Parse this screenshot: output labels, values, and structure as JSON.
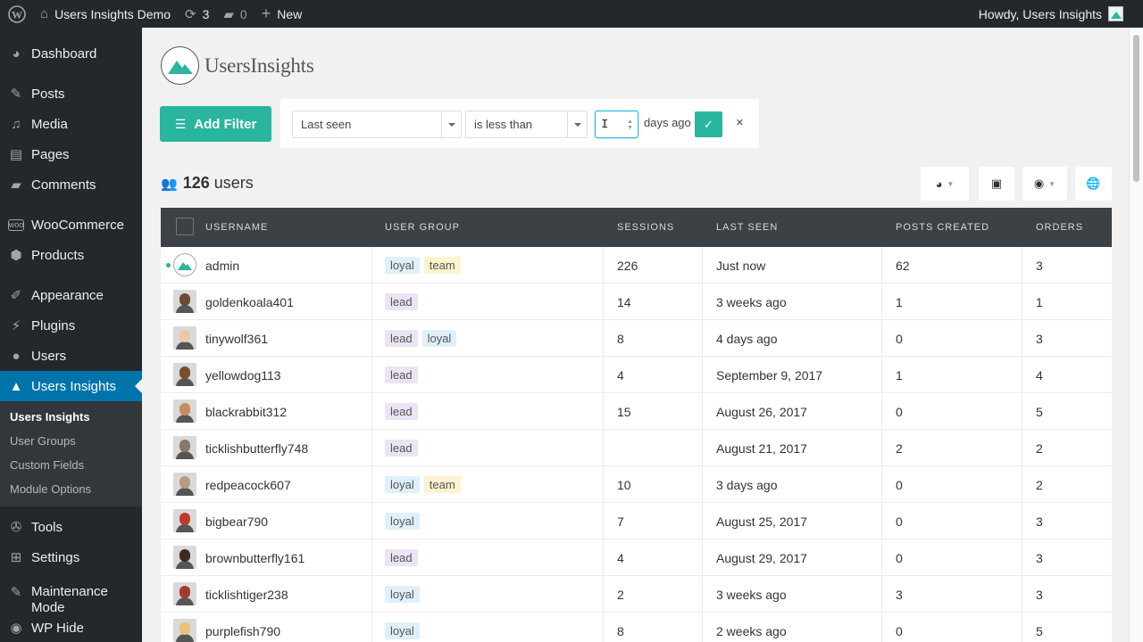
{
  "adminbar": {
    "site_name": "Users Insights Demo",
    "updates_count": "3",
    "comments_count": "0",
    "new_label": "New",
    "howdy": "Howdy, Users Insights"
  },
  "sidebar": {
    "items": [
      {
        "label": "Dashboard",
        "icon": "dashboard-icon"
      },
      {
        "label": "Posts",
        "icon": "pin-icon"
      },
      {
        "label": "Media",
        "icon": "media-icon"
      },
      {
        "label": "Pages",
        "icon": "pages-icon"
      },
      {
        "label": "Comments",
        "icon": "comments-icon"
      },
      {
        "label": "WooCommerce",
        "icon": "woo-icon"
      },
      {
        "label": "Products",
        "icon": "products-icon"
      },
      {
        "label": "Appearance",
        "icon": "brush-icon"
      },
      {
        "label": "Plugins",
        "icon": "plugin-icon"
      },
      {
        "label": "Users",
        "icon": "user-icon"
      },
      {
        "label": "Users Insights",
        "icon": "mountain-icon"
      }
    ],
    "submenu": [
      "Users Insights",
      "User Groups",
      "Custom Fields",
      "Module Options"
    ],
    "bottom_items": [
      {
        "label": "Tools",
        "icon": "wrench-icon"
      },
      {
        "label": "Settings",
        "icon": "settings-icon"
      },
      {
        "label": "Maintenance\nMode",
        "icon": "maintenance-icon"
      },
      {
        "label": "WP Hide",
        "icon": "hide-icon"
      }
    ]
  },
  "logo": {
    "text": "UsersInsights"
  },
  "filter": {
    "add_label": "Add Filter",
    "field": "Last seen",
    "operator": "is less than",
    "value_cursor": "I",
    "suffix": "days ago",
    "apply_symbol": "✓",
    "remove_symbol": "×"
  },
  "summary": {
    "count": "126",
    "label": "users"
  },
  "table": {
    "headers": [
      "USERNAME",
      "USER GROUP",
      "SESSIONS",
      "LAST SEEN",
      "POSTS CREATED",
      "ORDERS"
    ],
    "rows": [
      {
        "username": "admin",
        "groups": [
          "loyal",
          "team"
        ],
        "sessions": "226",
        "last_seen": "Just now",
        "posts": "62",
        "orders": "3",
        "online": true,
        "avatar": "logo"
      },
      {
        "username": "goldenkoala401",
        "groups": [
          "lead"
        ],
        "sessions": "14",
        "last_seen": "3 weeks ago",
        "posts": "1",
        "orders": "1",
        "avatar": "#6b4a33"
      },
      {
        "username": "tinywolf361",
        "groups": [
          "lead",
          "loyal"
        ],
        "sessions": "8",
        "last_seen": "4 days ago",
        "posts": "0",
        "orders": "3",
        "avatar": "#e9c9a8"
      },
      {
        "username": "yellowdog113",
        "groups": [
          "lead"
        ],
        "sessions": "4",
        "last_seen": "September 9, 2017",
        "posts": "1",
        "orders": "4",
        "avatar": "#7a4e2d"
      },
      {
        "username": "blackrabbit312",
        "groups": [
          "lead"
        ],
        "sessions": "15",
        "last_seen": "August 26, 2017",
        "posts": "0",
        "orders": "5",
        "avatar": "#c98a5e"
      },
      {
        "username": "ticklishbutterfly748",
        "groups": [
          "lead"
        ],
        "sessions": "",
        "last_seen": "August 21, 2017",
        "posts": "2",
        "orders": "2",
        "avatar": "#8a7766"
      },
      {
        "username": "redpeacock607",
        "groups": [
          "loyal",
          "team"
        ],
        "sessions": "10",
        "last_seen": "3 days ago",
        "posts": "0",
        "orders": "2",
        "avatar": "#b59b86"
      },
      {
        "username": "bigbear790",
        "groups": [
          "loyal"
        ],
        "sessions": "7",
        "last_seen": "August 25, 2017",
        "posts": "0",
        "orders": "3",
        "avatar": "#c0392b"
      },
      {
        "username": "brownbutterfly161",
        "groups": [
          "lead"
        ],
        "sessions": "4",
        "last_seen": "August 29, 2017",
        "posts": "0",
        "orders": "3",
        "avatar": "#3d2b20"
      },
      {
        "username": "ticklishtiger238",
        "groups": [
          "loyal"
        ],
        "sessions": "2",
        "last_seen": "3 weeks ago",
        "posts": "3",
        "orders": "3",
        "avatar": "#a33a2f"
      },
      {
        "username": "purplefish790",
        "groups": [
          "loyal"
        ],
        "sessions": "8",
        "last_seen": "2 weeks ago",
        "posts": "0",
        "orders": "5",
        "avatar": "#e8c27a"
      }
    ]
  },
  "colors": {
    "accent": "#2ab59e",
    "wp_blue": "#0073aa",
    "admin_dark": "#23282d",
    "table_header": "#3c4146"
  }
}
